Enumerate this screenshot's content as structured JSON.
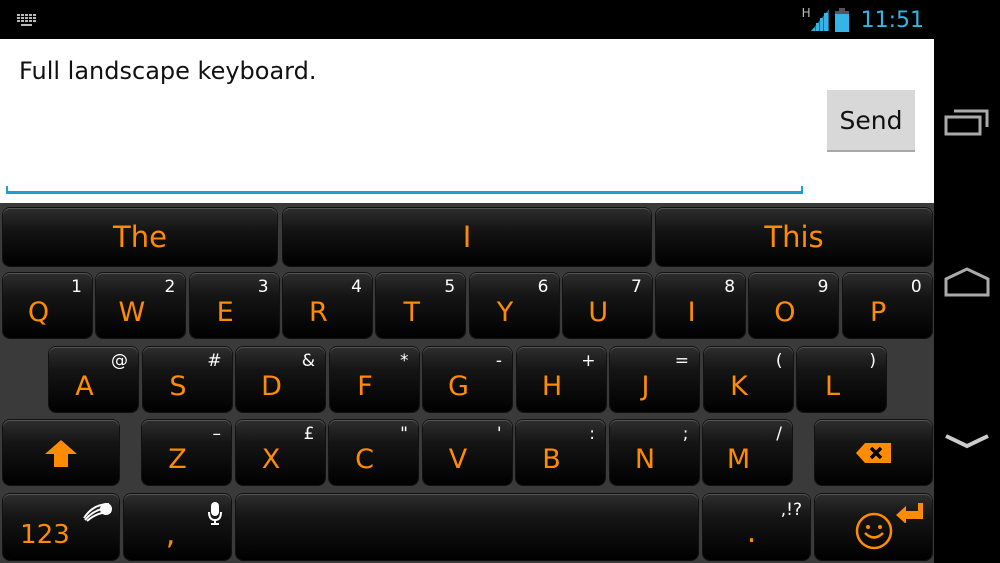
{
  "status_bar": {
    "notification_icon": "keyboard-icon",
    "network_type": "H",
    "signal_icon": "signal-icon",
    "battery_icon": "battery-icon",
    "time": "11:51",
    "accent_color": "#33b5e5"
  },
  "compose": {
    "message_text": "Full landscape keyboard.",
    "send_label": "Send"
  },
  "keyboard": {
    "key_color": "#ff8c00",
    "suggestions": [
      "The",
      "I",
      "This"
    ],
    "row1": [
      {
        "label": "Q",
        "sub": "1"
      },
      {
        "label": "W",
        "sub": "2"
      },
      {
        "label": "E",
        "sub": "3"
      },
      {
        "label": "R",
        "sub": "4"
      },
      {
        "label": "T",
        "sub": "5"
      },
      {
        "label": "Y",
        "sub": "6"
      },
      {
        "label": "U",
        "sub": "7"
      },
      {
        "label": "I",
        "sub": "8"
      },
      {
        "label": "O",
        "sub": "9"
      },
      {
        "label": "P",
        "sub": "0"
      }
    ],
    "row2": [
      {
        "label": "A",
        "sub": "@"
      },
      {
        "label": "S",
        "sub": "#"
      },
      {
        "label": "D",
        "sub": "&"
      },
      {
        "label": "F",
        "sub": "*"
      },
      {
        "label": "G",
        "sub": "-"
      },
      {
        "label": "H",
        "sub": "+"
      },
      {
        "label": "J",
        "sub": "="
      },
      {
        "label": "K",
        "sub": "("
      },
      {
        "label": "L",
        "sub": ")"
      }
    ],
    "row3": [
      {
        "label": "Z",
        "sub": "–"
      },
      {
        "label": "X",
        "sub": "£"
      },
      {
        "label": "C",
        "sub": "\""
      },
      {
        "label": "V",
        "sub": "'"
      },
      {
        "label": "B",
        "sub": ":"
      },
      {
        "label": "N",
        "sub": ";"
      },
      {
        "label": "M",
        "sub": "/"
      }
    ],
    "shift_icon": "shift-arrow-icon",
    "backspace_icon": "backspace-icon",
    "numbers_label": "123",
    "swiftkey_icon": "swiftkey-logo-icon",
    "comma_label": ",",
    "mic_icon": "microphone-icon",
    "period_label": ".",
    "period_sub": ",!?",
    "emoji_icon": "smiley-icon",
    "enter_icon": "enter-icon"
  },
  "navigation": {
    "recents": "recent-apps-icon",
    "home": "home-icon",
    "back": "back-chevron-icon"
  }
}
